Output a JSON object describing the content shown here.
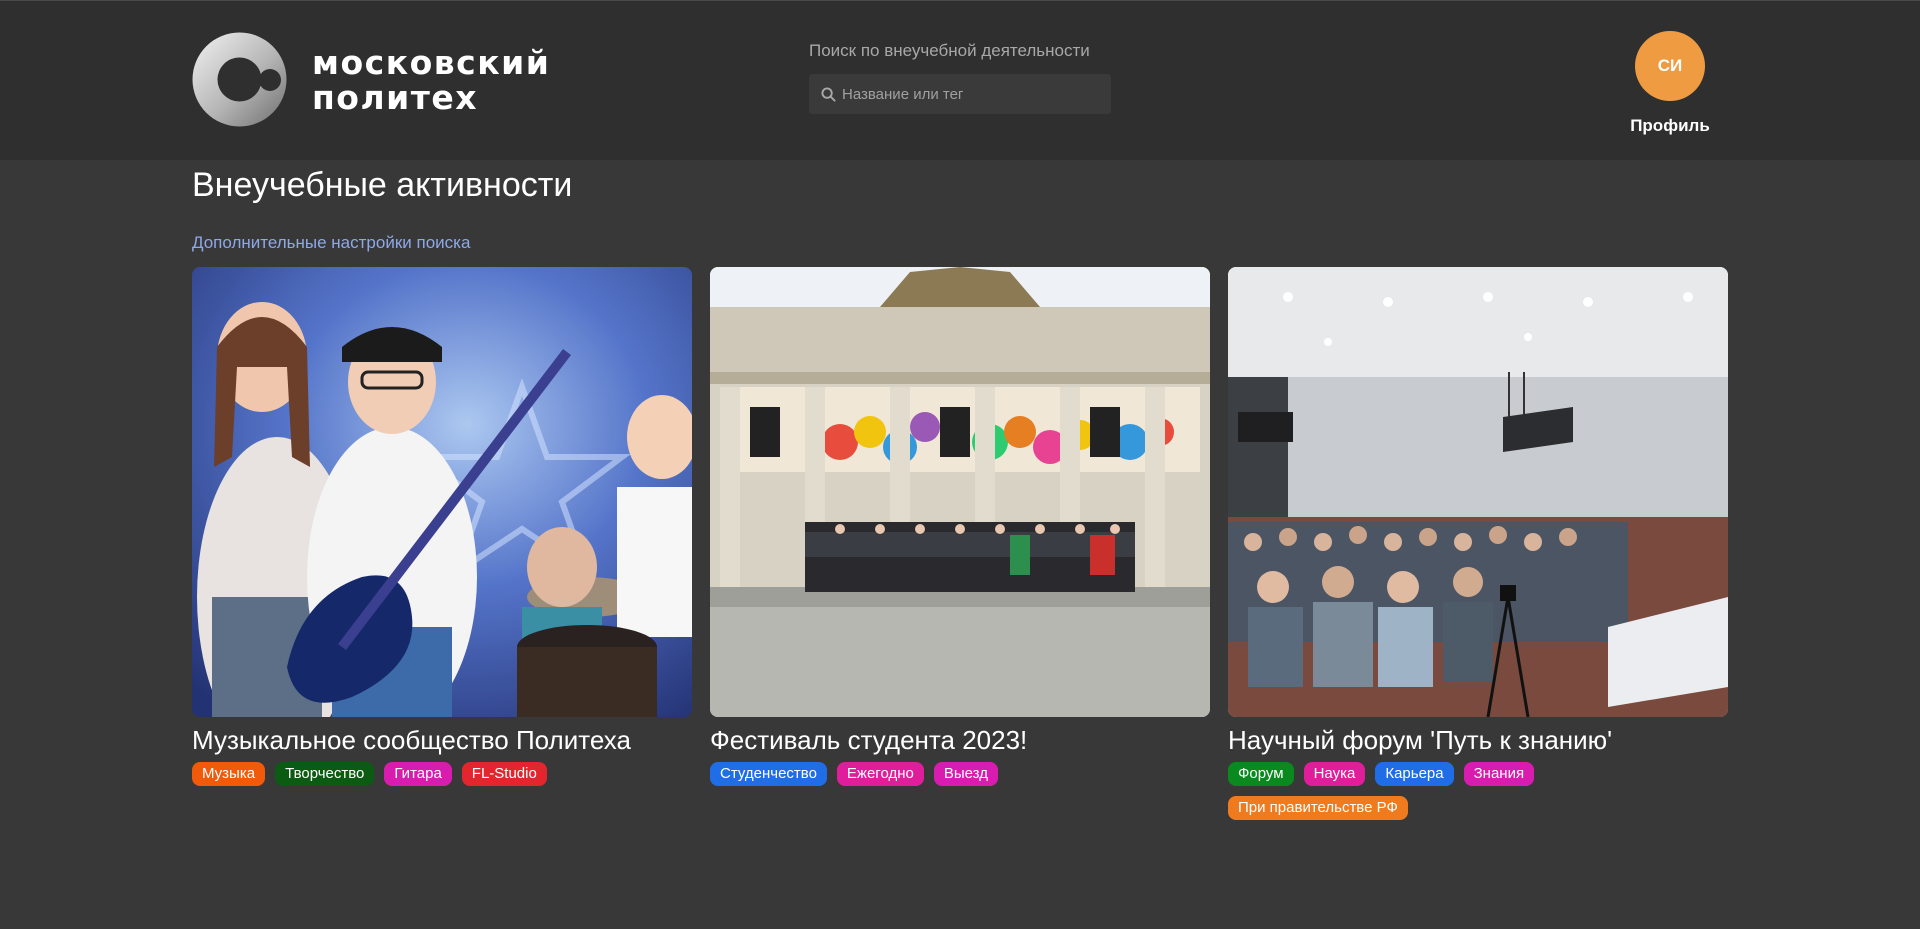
{
  "header": {
    "logo_line1": "московский",
    "logo_line2": "политех",
    "search_title": "Поиск по внеучебной деятельности",
    "search_placeholder": "Название или тег",
    "avatar_initials": "СИ",
    "profile_label": "Профиль"
  },
  "main": {
    "title": "Внеучебные активности",
    "advanced_search_link": "Дополнительные настройки поиска"
  },
  "cards": [
    {
      "title": "Музыкальное сообщество Политеха",
      "image": "children-music-band-photo",
      "tags": [
        {
          "label": "Музыка",
          "color": "#f05a0a"
        },
        {
          "label": "Творчество",
          "color": "#0b5c12"
        },
        {
          "label": "Гитара",
          "color": "#d81cb0"
        },
        {
          "label": "FL-Studio",
          "color": "#e3262e"
        }
      ]
    },
    {
      "title": "Фестиваль студента 2023!",
      "image": "festival-group-photo-at-arch",
      "tags": [
        {
          "label": "Студенчество",
          "color": "#1f6ee8"
        },
        {
          "label": "Ежегодно",
          "color": "#e01d9a"
        },
        {
          "label": "Выезд",
          "color": "#d81cb0"
        }
      ]
    },
    {
      "title": "Научный форум 'Путь к знанию'",
      "image": "conference-hall-audience-photo",
      "tags": [
        {
          "label": "Форум",
          "color": "#0a8a1e"
        },
        {
          "label": "Наука",
          "color": "#e01d9a"
        },
        {
          "label": "Карьера",
          "color": "#1f6ee8"
        },
        {
          "label": "Знания",
          "color": "#d81cb0"
        },
        {
          "label": "При правительстве РФ",
          "color": "#f07a1e"
        }
      ]
    }
  ],
  "colors": {
    "background": "#383838",
    "header_bg": "#2f2f2f",
    "accent_avatar": "#ef9b42",
    "link": "#8ea8e8"
  }
}
